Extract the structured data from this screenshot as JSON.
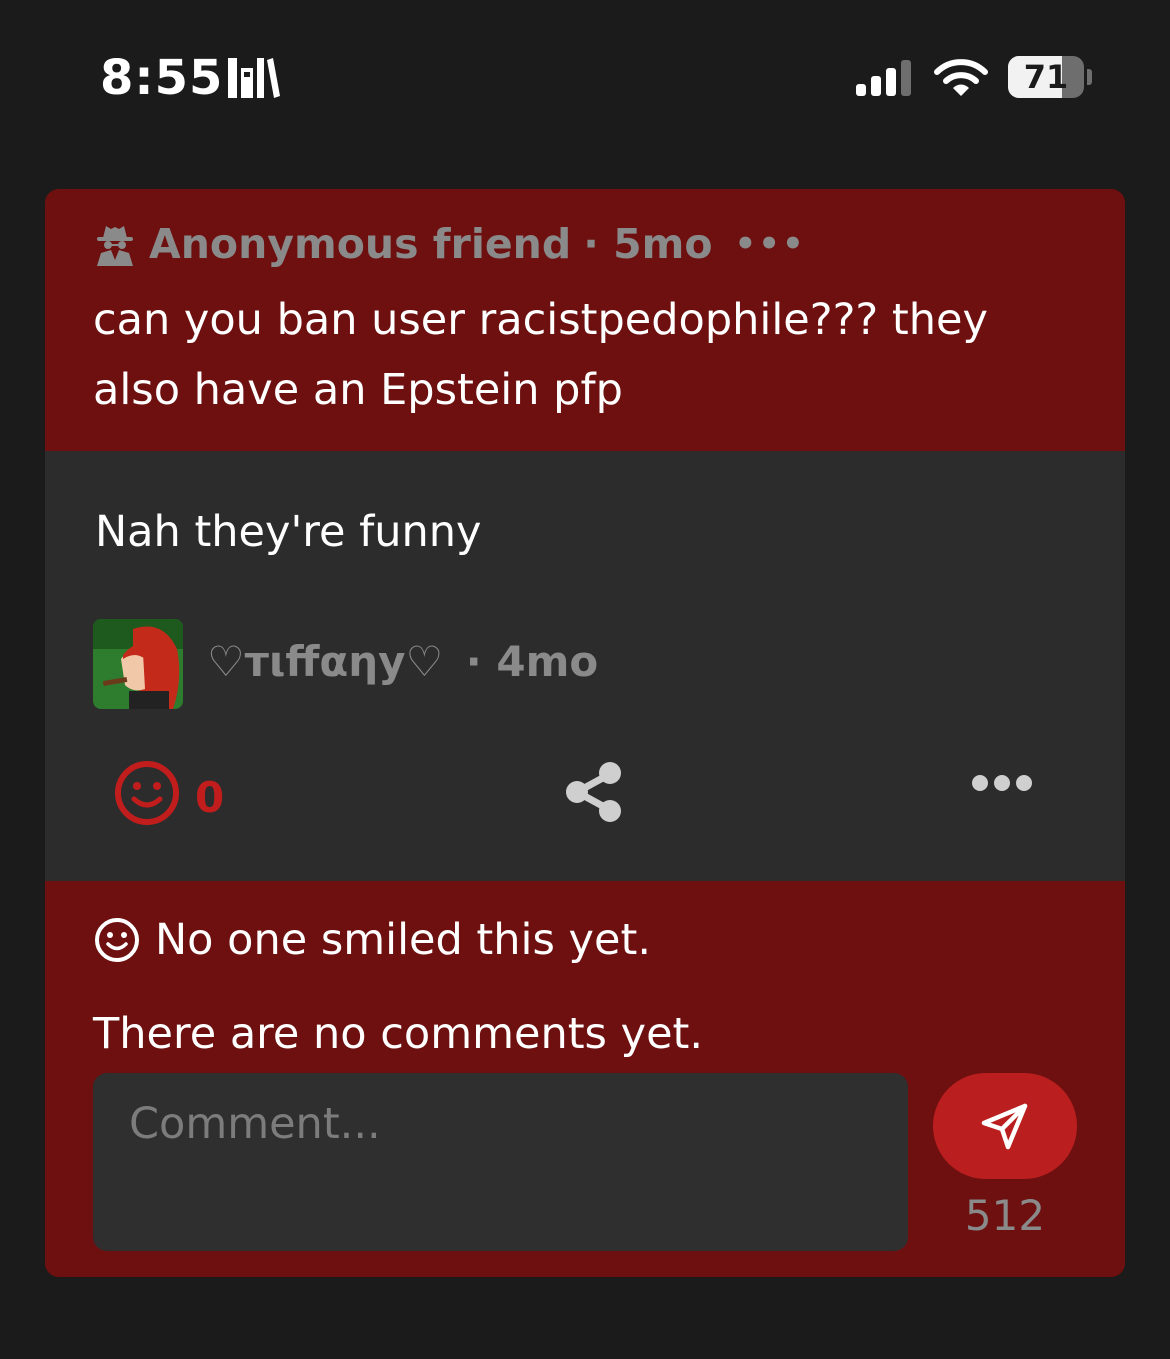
{
  "status_bar": {
    "time": "8:55",
    "battery_level": "71"
  },
  "question": {
    "author": "Anonymous friend",
    "age": "· 5mo",
    "more": "•••",
    "text": "can you ban user racistpedophile??? they also have an Epstein pfp"
  },
  "answer": {
    "text": "Nah they're funny",
    "author": "♡тιffαηy♡",
    "age": "· 4mo",
    "smile_count": "0"
  },
  "comments": {
    "smiled_text": "No one smiled this yet.",
    "empty_text": "There are no comments yet.",
    "input_placeholder": "Comment...",
    "char_limit": "512"
  },
  "colors": {
    "background": "#1b1b1b",
    "card_red": "#6e1010",
    "answer_gray": "#2c2c2c",
    "accent_red": "#bb1e1e",
    "muted_text": "#8a8a8a"
  },
  "icons": [
    "books-icon",
    "signal-icon",
    "wifi-icon",
    "battery-icon",
    "spy-icon",
    "smile-icon",
    "share-icon",
    "more-icon",
    "send-icon"
  ]
}
